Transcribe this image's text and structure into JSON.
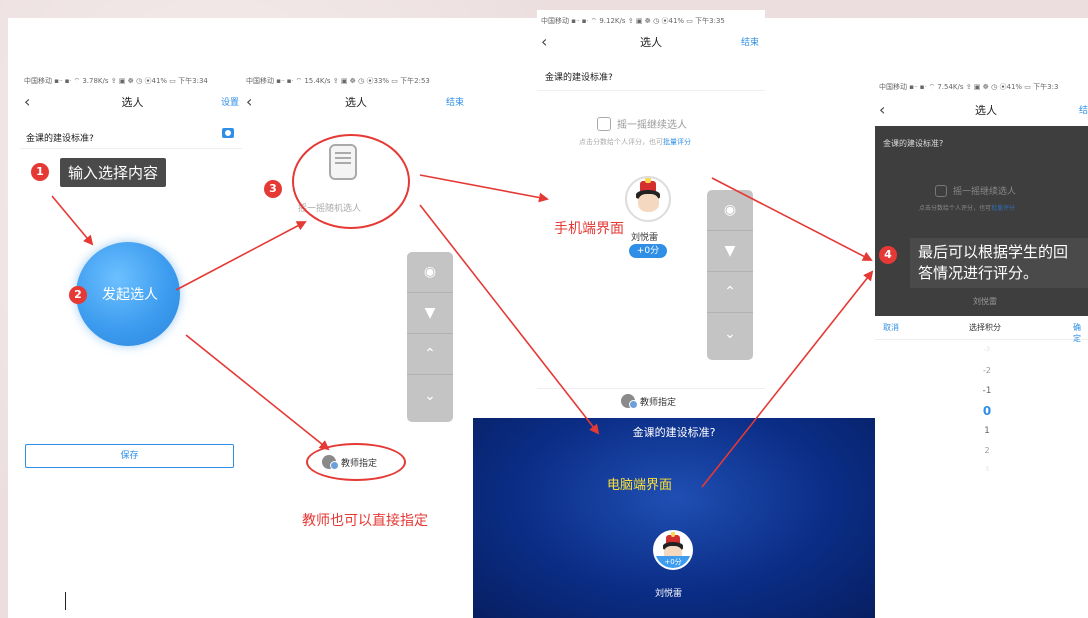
{
  "panel1": {
    "status": "中国移动 ▪ᐧᐧ ▪ᐧ ⌔ 3.78K/s ⇪   ▣ ☸ ◷ ⦿41% ▭ 下午3:34",
    "title": "选人",
    "action": "设置",
    "question": "金课的建设标准?",
    "step_num": "1",
    "callout": "输入选择内容",
    "step2_num": "2",
    "circle_label": "发起选人",
    "save_label": "保存"
  },
  "panel2": {
    "status": "中国移动 ▪ᐧᐧ ▪ᐧ ⌔ 15.4K/s ⇪   ▣ ☸ ◷ ⦿33% ▭ 下午2:53",
    "title": "选人",
    "action": "结束",
    "step_num": "3",
    "shake_label": "摇一摇随机选人",
    "teacher_label": "教师指定",
    "note": "教师也可以直接指定"
  },
  "panel3": {
    "status": "中国移动 ▪ᐧᐧ ▪ᐧ ⌔ 9.12K/s ⇪   ▣ ☸ ◷ ⦿41% ▭ 下午3:35",
    "title": "选人",
    "action": "结束",
    "question": "金课的建设标准?",
    "shake_label": "摇一摇继续选人",
    "hint_prefix": "点击分数给个人评分，也可",
    "hint_link": "批量评分",
    "phone_label": "手机端界面",
    "student": "刘悦雷",
    "score": "+0分",
    "teacher_label": "教师指定"
  },
  "pc": {
    "question": "金课的建设标准?",
    "label": "电脑端界面",
    "score": "+0分",
    "student": "刘悦雷"
  },
  "panel4": {
    "status": "中国移动 ▪ᐧᐧ ▪ᐧ ⌔ 7.54K/s ⇪   ▣ ☸ ◷ ⦿41% ▭ 下午3:3",
    "title": "选人",
    "action": "结束",
    "question": "金课的建设标准?",
    "shake_label": "摇一摇继续选人",
    "hint_prefix": "点击分数给个人评分，也可",
    "hint_link": "批量评分",
    "step_num": "4",
    "callout_line1": "最后可以根据学生的回",
    "callout_line2": "答情况进行评分。",
    "student": "刘悦雷",
    "picker_cancel": "取消",
    "picker_title": "选择积分",
    "picker_ok": "确定",
    "picker_values": [
      "-3",
      "-2",
      "-1",
      "0",
      "1",
      "2",
      "3"
    ]
  },
  "colors": {
    "accent": "#2f8fe6",
    "annotation_red": "#e53935",
    "pc_blue": "#0b2d86"
  }
}
